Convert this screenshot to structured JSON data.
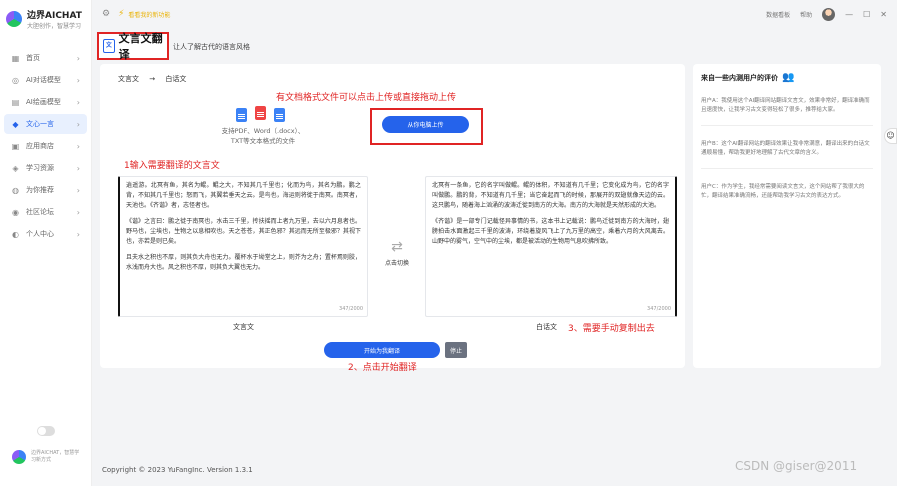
{
  "brand": {
    "name": "边界AICHAT",
    "tagline": "大胆创作，智慧学习"
  },
  "sidebar": {
    "items": [
      {
        "icon": "▦",
        "label": "首页",
        "active": false
      },
      {
        "icon": "◎",
        "label": "AI对话模型",
        "active": false
      },
      {
        "icon": "▤",
        "label": "AI绘画模型",
        "active": false
      },
      {
        "icon": "◆",
        "label": "文心一言",
        "active": true
      },
      {
        "icon": "▣",
        "label": "应用商店",
        "active": false
      },
      {
        "icon": "◈",
        "label": "学习资源",
        "active": false
      },
      {
        "icon": "◍",
        "label": "为你推荐",
        "active": false
      },
      {
        "icon": "◉",
        "label": "社区论坛",
        "active": false
      },
      {
        "icon": "◐",
        "label": "个人中心",
        "active": false
      }
    ],
    "footer_text": "边界AICHAT，智慧学习新方式"
  },
  "topbar": {
    "promo": "看看我的新功能",
    "right": [
      "数据看板",
      "帮助"
    ]
  },
  "page": {
    "title": "文言文翻译",
    "subtitle": "让人了解古代的语言风格"
  },
  "translator": {
    "lang_from": "文言文",
    "lang_arrow": "→",
    "lang_to": "白话文",
    "upload_note": "有文档格式文件可以点击上传或直接拖动上传",
    "support_text": "支持PDF、Word（.docx）、TXT等文本格式的文件 ",
    "upload_button": "从你电脑上传",
    "note1": "1输入需要翻译的文言文",
    "source_paragraphs": [
      "逍遥游。北冥有鱼，其名为鲲。鲲之大，不知其几千里也；化而为鸟，其名为鹏。鹏之背，不知其几千里也；怒而飞，其翼若垂天之云。是鸟也，海运则将徙于南冥。南冥者，天池也。《齐谐》者，志怪者也。",
      "《谐》之言曰：鹏之徙于南冥也，水击三千里，抟扶摇而上者九万里，去以六月息者也。野马也，尘埃也，生物之以息相吹也。天之苍苍，其正色邪？其远而无所至极邪？其视下也，亦若是则已矣。",
      "且夫水之积也不厚，则其负大舟也无力。覆杯水于坳堂之上，则芥为之舟；置杯焉则胶，水浅而舟大也。风之积也不厚，则其负大翼也无力。"
    ],
    "source_counter": "347/2000",
    "swap_label": "点击切换",
    "target_paragraphs": [
      "北冥有一条鱼，它的名字叫做鲲。鲲的体积，不知道有几千里；它变化成为鸟，它的名字叫做鹏。鹏的背，不知道有几千里；当它奋起而飞的时候，那展开的双翅就像天边的云。这只鹏鸟，随着海上汹涌的波涛迁徙到南方的大海。南方的大海就是天然形成的大池。",
      "《齐谐》是一部专门记载怪异事情的书，这本书上记载说：鹏鸟迁徙到南方的大海时，翅膀拍击水面激起三千里的波涛，环绕着旋风飞上了九万里的高空，乘着六月的大风离去。山野中的雾气，空气中的尘埃，都是被活动的生物用气息吹拂所致。"
    ],
    "target_counter": "347/2000",
    "source_label": "文言文",
    "target_label": "白话文",
    "note3": "3、需要手动复制出去",
    "translate_button": "开始为我翻译",
    "stop_button": "停止",
    "note2": "2、点击开始翻译"
  },
  "reviews": {
    "title": "来自一些内测用户的评价",
    "items": [
      "用户A：我使用这个AI翻译网站翻译文言文，效果非常好，翻译准确而且速度快，让我学习古文变得轻松了很多，推荐给大家。",
      "用户B：这个AI翻译网站的翻译效果让我非常满意，翻译出来的白话文通顺易懂，帮助我更好地理解了古代文章的含义。",
      "用户C：作为学生，我经常需要阅读文言文，这个网站帮了我很大的忙，翻译结果准确流畅，还能帮助我学习古文的表达方式。"
    ]
  },
  "footer": {
    "copyright": "Copyright © 2023 YuFangInc. Version 1.3.1",
    "watermark": "CSDN @giser@2011"
  }
}
